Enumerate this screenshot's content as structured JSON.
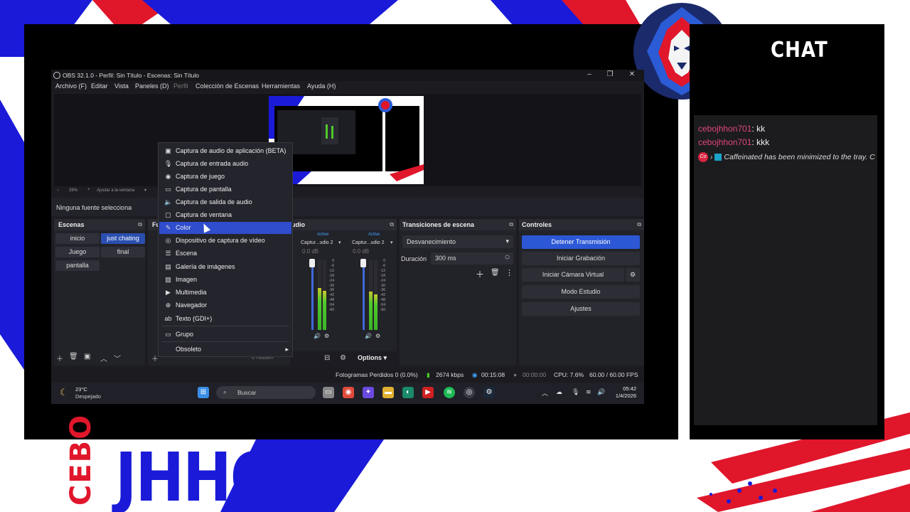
{
  "obs": {
    "window_title": "OBS 32.1.0 - Perfil: Sin Título - Escenas: Sin Título",
    "menu": [
      "Archivo (F)",
      "Editar",
      "Vista",
      "Paneles (D)",
      "Perfil",
      "Colección de Escenas",
      "Herramientas",
      "Ayuda (H)"
    ],
    "zoom": "26%",
    "zoom_fit": "Ajustar a la ventana",
    "no_source": "Ninguna fuente selecciona",
    "scenes_title": "Escenas",
    "scenes": [
      "inicio",
      "just chating",
      "Juego",
      "final",
      "pantalla"
    ],
    "active_scene": "just chating",
    "sources_title_partial": "Fu",
    "hidden_label": "0 hidden",
    "mixer_title_partial": "udio",
    "mixer_channels": [
      {
        "name": "Captur...udio 2",
        "status": "Active",
        "db": "0.0 dB",
        "level": 0.6
      },
      {
        "name": "Captur...udio 2",
        "status": "Active",
        "db": "0.0 dB",
        "level": 0.55
      }
    ],
    "mixer_scale": [
      "0",
      "-6",
      "-12",
      "-18",
      "-24",
      "-30",
      "-36",
      "-42",
      "-48",
      "-54",
      "-60"
    ],
    "options_label": "Options",
    "transitions_title": "Transiciones de escena",
    "transition": "Desvanecimiento",
    "duration_label": "Duración",
    "duration_value": "300 ms",
    "controls_title": "Controles",
    "controls": [
      "Detener Transmisión",
      "Iniciar Grabación",
      "Iniciar Cámara Virtual",
      "Modo Estudio",
      "Ajustes"
    ],
    "status": {
      "dropped": "Fotogramas Perdidos 0 (0.0%)",
      "bitrate": "2674 kbps",
      "stream_time": "00:15:08",
      "rec_time": "00:00:00",
      "cpu": "CPU: 7.6%",
      "fps": "60.00 / 60.00 FPS"
    }
  },
  "context_menu": {
    "items": [
      {
        "label": "Captura de audio de aplicación (BETA)",
        "icon": "app-audio-icon"
      },
      {
        "label": "Captura de entrada audio",
        "icon": "microphone-icon"
      },
      {
        "label": "Captura de juego",
        "icon": "gamepad-icon"
      },
      {
        "label": "Captura de pantalla",
        "icon": "monitor-icon"
      },
      {
        "label": "Captura de salida de audio",
        "icon": "speaker-icon"
      },
      {
        "label": "Captura de ventana",
        "icon": "window-icon"
      },
      {
        "label": "Color",
        "icon": "brush-icon"
      },
      {
        "label": "Dispositivo de captura de vídeo",
        "icon": "camera-icon"
      },
      {
        "label": "Escena",
        "icon": "list-icon"
      },
      {
        "label": "Galería de imágenes",
        "icon": "slideshow-icon"
      },
      {
        "label": "Imagen",
        "icon": "image-icon"
      },
      {
        "label": "Multimedia",
        "icon": "play-icon"
      },
      {
        "label": "Navegador",
        "icon": "globe-icon"
      },
      {
        "label": "Texto (GDI+)",
        "icon": "text-icon"
      }
    ],
    "hovered": "Color",
    "group": "Grupo",
    "deprecated": "Obsoleto"
  },
  "taskbar": {
    "temp": "23°C",
    "weather": "Despejado",
    "search": "Buscar",
    "time": "05:42",
    "date": "1/4/2026"
  },
  "chat": {
    "title": "CHAT",
    "messages": [
      {
        "user": "cebojhhon701",
        "text": "kk"
      },
      {
        "user": "cebojhhon701",
        "text": "kkk"
      }
    ],
    "system_message": "Caffeinated has been minimized to the tray. C",
    "system_badge": "Co"
  },
  "branding": {
    "name_top": "CEBO",
    "name_main": "JHHON"
  },
  "colors": {
    "brand_red": "#e0162b",
    "brand_blue": "#1a1ad8",
    "obs_accent": "#2c58d6",
    "chat_user": "#e0457b"
  }
}
